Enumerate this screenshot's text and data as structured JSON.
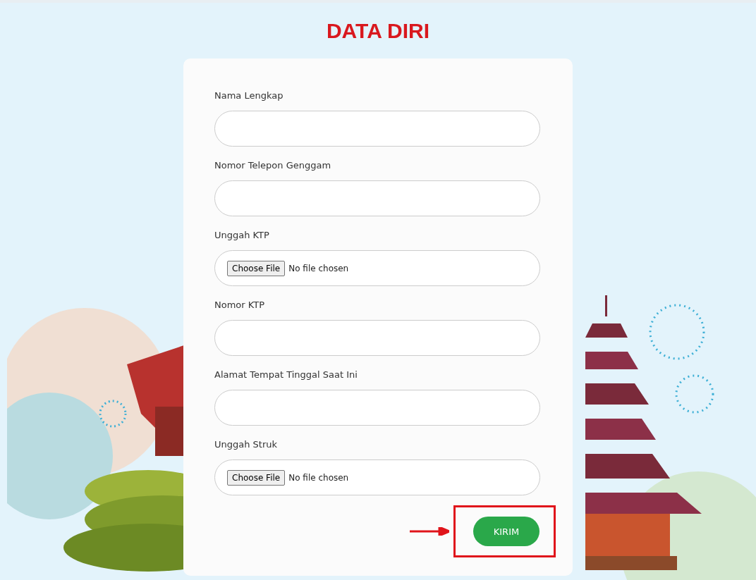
{
  "page": {
    "title": "DATA DIRI"
  },
  "form": {
    "fields": [
      {
        "kind": "text",
        "label": "Nama Lengkap"
      },
      {
        "kind": "text",
        "label": "Nomor Telepon Genggam"
      },
      {
        "kind": "file",
        "label": "Unggah KTP",
        "button": "Choose File",
        "status": "No file chosen"
      },
      {
        "kind": "text",
        "label": "Nomor KTP"
      },
      {
        "kind": "text",
        "label": "Alamat Tempat Tinggal Saat Ini"
      },
      {
        "kind": "file",
        "label": "Unggah Struk",
        "button": "Choose File",
        "status": "No file chosen"
      }
    ],
    "submit": {
      "label": "KIRIM",
      "highlighted": true
    }
  }
}
